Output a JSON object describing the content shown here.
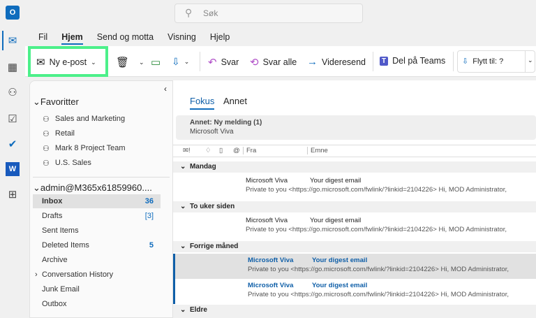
{
  "search": {
    "placeholder": "Søk"
  },
  "ribbon_tabs": [
    "Fil",
    "Hjem",
    "Send og motta",
    "Visning",
    "Hjelp"
  ],
  "toolbar": {
    "new_mail": "Ny e-post",
    "reply": "Svar",
    "reply_all": "Svar alle",
    "forward": "Videresend",
    "teams": "Del på Teams",
    "move_to": "Flytt til: ?"
  },
  "folders": {
    "favorites_title": "Favoritter",
    "favorites": [
      "Sales and Marketing",
      "Retail",
      "Mark 8 Project Team",
      "U.S. Sales"
    ],
    "account": "admin@M365x61859960....",
    "items": [
      {
        "label": "Inbox",
        "count": "36"
      },
      {
        "label": "Drafts",
        "count": "[3]"
      },
      {
        "label": "Sent Items",
        "count": ""
      },
      {
        "label": "Deleted Items",
        "count": "5"
      },
      {
        "label": "Archive",
        "count": ""
      },
      {
        "label": "Conversation History",
        "count": ""
      },
      {
        "label": "Junk Email",
        "count": ""
      },
      {
        "label": "Outbox",
        "count": ""
      }
    ]
  },
  "list": {
    "tabs": [
      "Fokus",
      "Annet"
    ],
    "notice_title": "Annet: Ny melding (1)",
    "notice_sender": "Microsoft Viva",
    "col_from": "Fra",
    "col_subject": "Emne",
    "groups": [
      "Mandag",
      "To uker siden",
      "Forrige måned",
      "Eldre"
    ],
    "messages": [
      {
        "from": "Microsoft Viva",
        "subject": "Your digest email",
        "preview": "Private to you <https://go.microsoft.com/fwlink/?linkid=2104226>   Hi, MOD Administrator,"
      },
      {
        "from": "Microsoft Viva",
        "subject": "Your digest email",
        "preview": "Private to you <https://go.microsoft.com/fwlink/?linkid=2104226>   Hi, MOD Administrator,"
      },
      {
        "from": "Microsoft Viva",
        "subject": "Your digest email",
        "preview": "Private to you <https://go.microsoft.com/fwlink/?linkid=2104226>   Hi, MOD Administrator,"
      },
      {
        "from": "Microsoft Viva",
        "subject": "Your digest email",
        "preview": "Private to you <https://go.microsoft.com/fwlink/?linkid=2104226>   Hi, MOD Administrator,"
      }
    ]
  },
  "colors": {
    "accent": "#0f6cbd",
    "highlight": "#4cf08a"
  }
}
